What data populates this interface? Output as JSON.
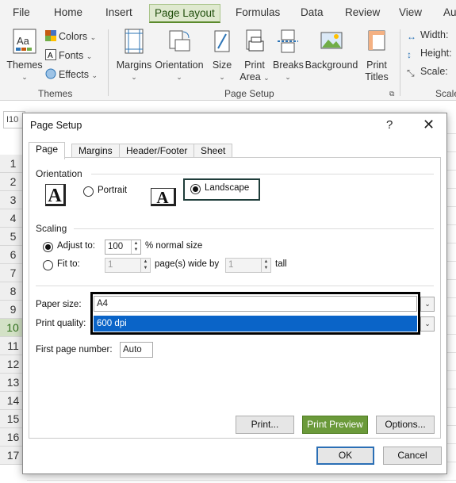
{
  "ribbon_tabs": [
    "File",
    "Home",
    "Insert",
    "Page Layout",
    "Formulas",
    "Data",
    "Review",
    "View",
    "Au"
  ],
  "ribbon": {
    "themes": {
      "label": "Themes",
      "colors": "Colors",
      "fonts": "Fonts",
      "effects": "Effects",
      "group": "Themes"
    },
    "page_setup": {
      "margins": "Margins",
      "orientation": "Orientation",
      "size": "Size",
      "print_area_1": "Print",
      "print_area_2": "Area",
      "breaks": "Breaks",
      "background": "Background",
      "print_titles_1": "Print",
      "print_titles_2": "Titles",
      "group": "Page Setup"
    },
    "scale": {
      "width": "Width:",
      "height": "Height:",
      "scale": "Scale:",
      "group": "Scale"
    }
  },
  "namebox": "I10",
  "rows": [
    "1",
    "2",
    "3",
    "4",
    "5",
    "6",
    "7",
    "8",
    "9",
    "10",
    "11",
    "12",
    "13",
    "14",
    "15",
    "16",
    "17"
  ],
  "selected_row": "10",
  "dialog": {
    "title": "Page Setup",
    "help": "?",
    "close": "✕",
    "tabs": [
      "Page",
      "Margins",
      "Header/Footer",
      "Sheet"
    ],
    "orientation": {
      "section": "Orientation",
      "portrait": "Portrait",
      "landscape": "Landscape",
      "selected": "landscape"
    },
    "scaling": {
      "section": "Scaling",
      "adjust_to": "Adjust to:",
      "adjust_value": "100",
      "normal_size": "% normal size",
      "fit_to": "Fit to:",
      "fit_wide": "1",
      "pages_wide": "page(s) wide by",
      "fit_tall": "1",
      "tall": "tall",
      "selected": "adjust"
    },
    "paper_size": {
      "label": "Paper size:",
      "value": "A4"
    },
    "print_quality": {
      "label": "Print quality:",
      "value": "600 dpi"
    },
    "first_page": {
      "label": "First page number:",
      "value": "Auto"
    },
    "buttons": {
      "print": "Print...",
      "print_preview": "Print Preview",
      "options": "Options...",
      "ok": "OK",
      "cancel": "Cancel"
    }
  },
  "colors": {
    "accent_green": "#6b9a3a",
    "highlight_blue": "#0a64c8",
    "ok_border": "#2b6fb5"
  }
}
